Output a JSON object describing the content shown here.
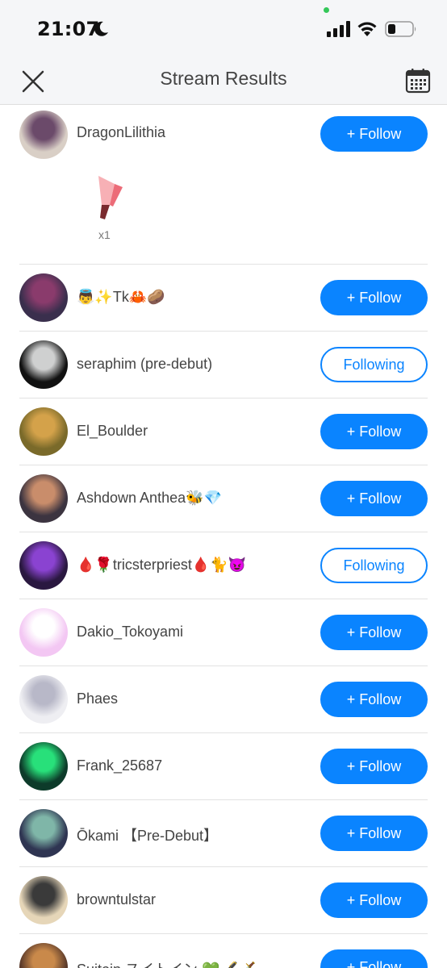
{
  "status_bar": {
    "time": "21:07"
  },
  "header": {
    "title": "Stream Results"
  },
  "gift": {
    "count": "x1"
  },
  "rows": [
    {
      "name": "DragonLilithia",
      "button": "+ Follow",
      "following": false,
      "avatar_color": "#d9cfc6",
      "avatar_accent": "#6b4a6a"
    },
    {
      "name": "👼✨Tk🦀🥔",
      "button": "+ Follow",
      "following": false,
      "avatar_color": "#3a2f4d",
      "avatar_accent": "#8a3b6c"
    },
    {
      "name": "seraphim (pre-debut)",
      "button": "Following",
      "following": true,
      "avatar_color": "#111111",
      "avatar_accent": "#cfd0d0"
    },
    {
      "name": "El_Boulder",
      "button": "+ Follow",
      "following": false,
      "avatar_color": "#7a6a2a",
      "avatar_accent": "#d4a24a"
    },
    {
      "name": "Ashdown Anthea🐝💎",
      "button": "+ Follow",
      "following": false,
      "avatar_color": "#3c3440",
      "avatar_accent": "#c98d6b"
    },
    {
      "name": "🩸🌹tricsterpriest🩸🐈😈",
      "button": "Following",
      "following": true,
      "avatar_color": "#2a1840",
      "avatar_accent": "#8a43d1"
    },
    {
      "name": "Dakio_Tokoyami",
      "button": "+ Follow",
      "following": false,
      "avatar_color": "#f3c7f3",
      "avatar_accent": "#ffffff"
    },
    {
      "name": "Phaes",
      "button": "+ Follow",
      "following": false,
      "avatar_color": "#eeeef2",
      "avatar_accent": "#b8b8c8"
    },
    {
      "name": "Frank_25687",
      "button": "+ Follow",
      "following": false,
      "avatar_color": "#0d3b2a",
      "avatar_accent": "#28e07a"
    },
    {
      "name": "Ōkami 【Pre-Debut】",
      "button": "+ Follow",
      "following": false,
      "avatar_color": "#2f3552",
      "avatar_accent": "#7fb6a8"
    },
    {
      "name": "browntulstar",
      "button": "+ Follow",
      "following": false,
      "avatar_color": "#e6d6b8",
      "avatar_accent": "#3a3a3a"
    },
    {
      "name": "Suitoin スイトイン 💚🖋️🗡️",
      "button": "+ Follow",
      "following": false,
      "avatar_color": "#5b3a2a",
      "avatar_accent": "#c9894a"
    }
  ],
  "icons": {
    "close": "close-icon",
    "calendar": "calendar-icon",
    "gift": "gift-icon"
  }
}
